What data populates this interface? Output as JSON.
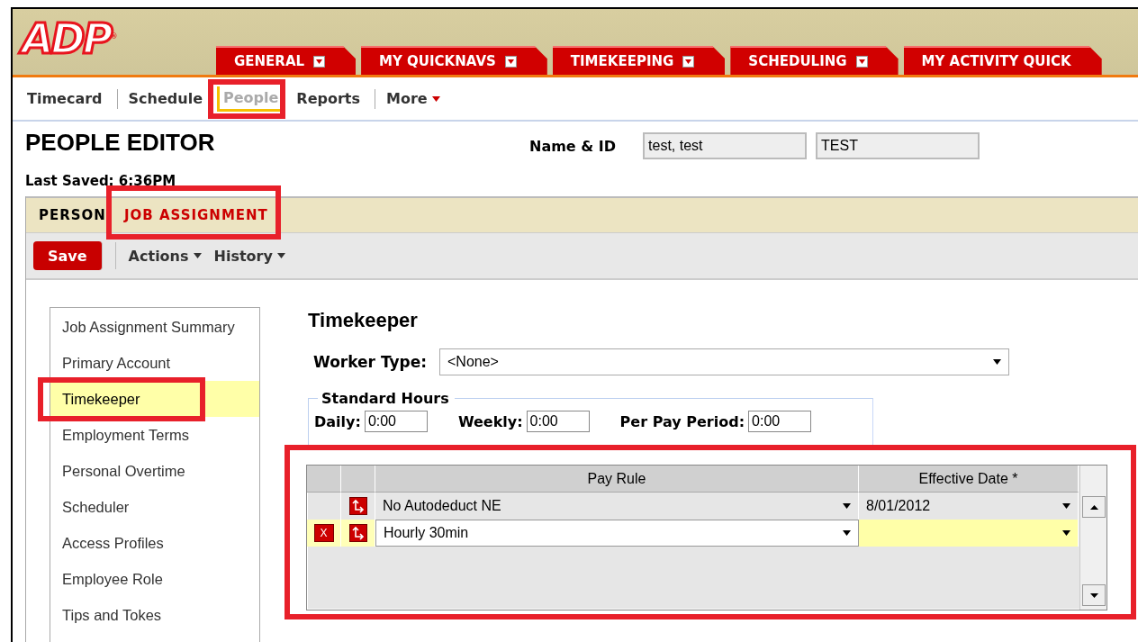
{
  "logo": {
    "text": "ADP",
    "mark": "®"
  },
  "main_tabs": [
    {
      "label": "GENERAL",
      "menu": true
    },
    {
      "label": "MY QUICKNAVS",
      "menu": true
    },
    {
      "label": "TIMEKEEPING",
      "menu": true
    },
    {
      "label": "SCHEDULING",
      "menu": true
    },
    {
      "label": "MY ACTIVITY QUICK",
      "menu": false
    }
  ],
  "sub_nav": [
    {
      "label": "Timecard",
      "selected": false,
      "highlighted": false,
      "menu": false
    },
    {
      "label": "Schedule",
      "selected": false,
      "highlighted": false,
      "menu": false
    },
    {
      "label": "People",
      "selected": true,
      "highlighted": true,
      "menu": false
    },
    {
      "label": "Reports",
      "selected": false,
      "highlighted": false,
      "menu": false
    },
    {
      "label": "More",
      "selected": false,
      "highlighted": false,
      "menu": true
    }
  ],
  "page": {
    "title": "PEOPLE EDITOR",
    "last_saved": "Last Saved: 6:36PM",
    "name_label": "Name & ID",
    "name_value": "test, test",
    "id_value": "TEST"
  },
  "editor_tabs": [
    {
      "label": "PERSON",
      "selected": false,
      "highlighted": false
    },
    {
      "label": "JOB ASSIGNMENT",
      "selected": true,
      "highlighted": true
    }
  ],
  "toolbar": {
    "save": "Save",
    "menus": [
      "Actions",
      "History"
    ]
  },
  "sidebar": {
    "items": [
      {
        "label": "Job Assignment Summary",
        "selected": false,
        "highlighted": false
      },
      {
        "label": "Primary Account",
        "selected": false,
        "highlighted": false
      },
      {
        "label": "Timekeeper",
        "selected": true,
        "highlighted": true
      },
      {
        "label": "Employment Terms",
        "selected": false,
        "highlighted": false
      },
      {
        "label": "Personal Overtime",
        "selected": false,
        "highlighted": false
      },
      {
        "label": "Scheduler",
        "selected": false,
        "highlighted": false
      },
      {
        "label": "Access Profiles",
        "selected": false,
        "highlighted": false
      },
      {
        "label": "Employee Role",
        "selected": false,
        "highlighted": false
      },
      {
        "label": "Tips and Tokes",
        "selected": false,
        "highlighted": false
      }
    ]
  },
  "section": {
    "title": "Timekeeper",
    "worker_type_label": "Worker Type:",
    "worker_type_value": "<None>",
    "standard_hours": {
      "legend": "Standard Hours",
      "fields": [
        {
          "label": "Daily:",
          "value": "0:00"
        },
        {
          "label": "Weekly:",
          "value": "0:00"
        },
        {
          "label": "Per Pay Period:",
          "value": "0:00"
        }
      ]
    }
  },
  "pay_rule_table": {
    "highlighted": true,
    "columns": [
      "Pay Rule",
      "Effective Date *"
    ],
    "rows": [
      {
        "deletable": false,
        "selected": false,
        "pay_rule": "No Autodeduct NE",
        "effective_date": "8/01/2012"
      },
      {
        "deletable": true,
        "selected": true,
        "pay_rule": "Hourly 30min",
        "effective_date": "",
        "delete_label": "X"
      }
    ]
  }
}
